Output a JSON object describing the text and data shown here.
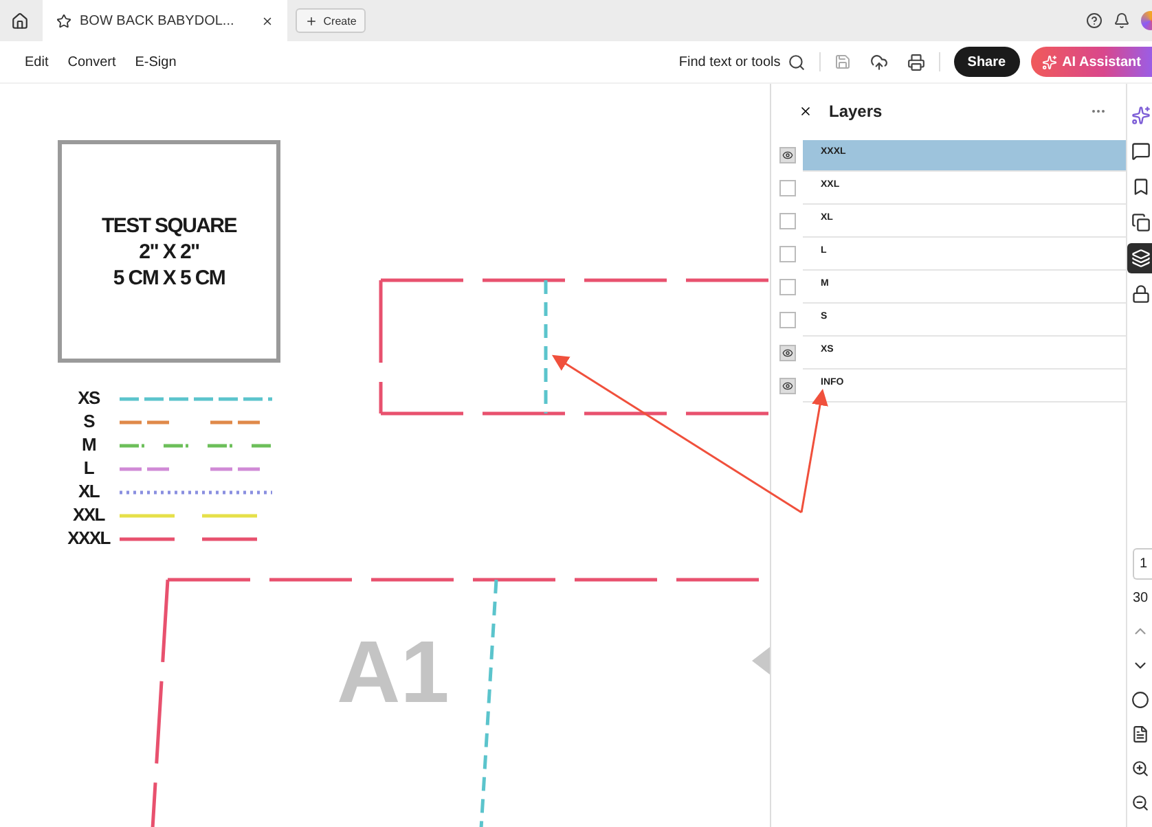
{
  "tab_bar": {
    "tabs": [
      {
        "title": "BOW BACK BABYDOL...",
        "selected": true
      }
    ],
    "create_button": "Create"
  },
  "toolbar": {
    "menu": [
      "Edit",
      "Convert",
      "E-Sign"
    ],
    "find": "Find text or tools",
    "share": "Share",
    "ai_assistant": "AI Assistant"
  },
  "document": {
    "test_square": {
      "lines": [
        "TEST SQUARE",
        "2\" X 2\"",
        "5 CM X 5 CM"
      ]
    },
    "legend": [
      {
        "size": "XS",
        "color": "#5bc4cc",
        "kind": "dashed"
      },
      {
        "size": "S",
        "color": "#e0894a",
        "kind": "gapped"
      },
      {
        "size": "M",
        "color": "#6cbf5a",
        "kind": "dash-dot"
      },
      {
        "size": "L",
        "color": "#d08ad6",
        "kind": "gapped"
      },
      {
        "size": "XL",
        "color": "#8a8fe0",
        "kind": "dotted"
      },
      {
        "size": "XXL",
        "color": "#e6e04a",
        "kind": "long"
      },
      {
        "size": "XXXL",
        "color": "#e8516e",
        "kind": "long"
      }
    ],
    "piece_label": "A1"
  },
  "layers_panel": {
    "title": "Layers",
    "items": [
      {
        "label": "XXXL",
        "visible": true,
        "selected": true
      },
      {
        "label": "XXL",
        "visible": false,
        "selected": false
      },
      {
        "label": "XL",
        "visible": false,
        "selected": false
      },
      {
        "label": "L",
        "visible": false,
        "selected": false
      },
      {
        "label": "M",
        "visible": false,
        "selected": false
      },
      {
        "label": "S",
        "visible": false,
        "selected": false
      },
      {
        "label": "XS",
        "visible": true,
        "selected": false
      },
      {
        "label": "INFO",
        "visible": true,
        "selected": false
      }
    ]
  },
  "right_rail": {
    "tools": [
      {
        "kind": "ai",
        "selected": false
      },
      {
        "kind": "comment",
        "selected": false
      },
      {
        "kind": "bookmark",
        "selected": false
      },
      {
        "kind": "pages",
        "selected": false
      },
      {
        "kind": "layers",
        "selected": true
      },
      {
        "kind": "lock",
        "selected": false
      }
    ],
    "page_field": "1",
    "page_count": "30"
  }
}
